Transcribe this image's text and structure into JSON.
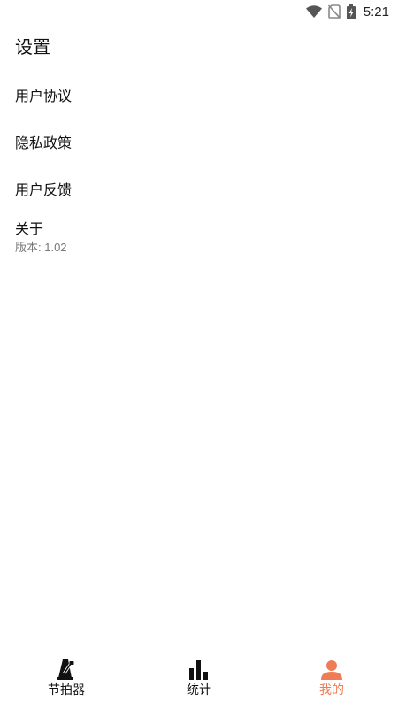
{
  "status_bar": {
    "time": "5:21"
  },
  "page": {
    "title": "设置"
  },
  "menu": {
    "items": [
      {
        "label": "用户协议"
      },
      {
        "label": "隐私政策"
      },
      {
        "label": "用户反馈"
      },
      {
        "label": "关于",
        "sub": "版本: 1.02"
      }
    ]
  },
  "bottom_nav": {
    "items": [
      {
        "label": "节拍器",
        "icon": "metronome-icon"
      },
      {
        "label": "统计",
        "icon": "bar-chart-icon"
      },
      {
        "label": "我的",
        "icon": "person-icon",
        "active": true
      }
    ]
  },
  "colors": {
    "accent": "#f07c55",
    "text": "#111111",
    "secondary_text": "#777777",
    "background": "#ffffff"
  }
}
